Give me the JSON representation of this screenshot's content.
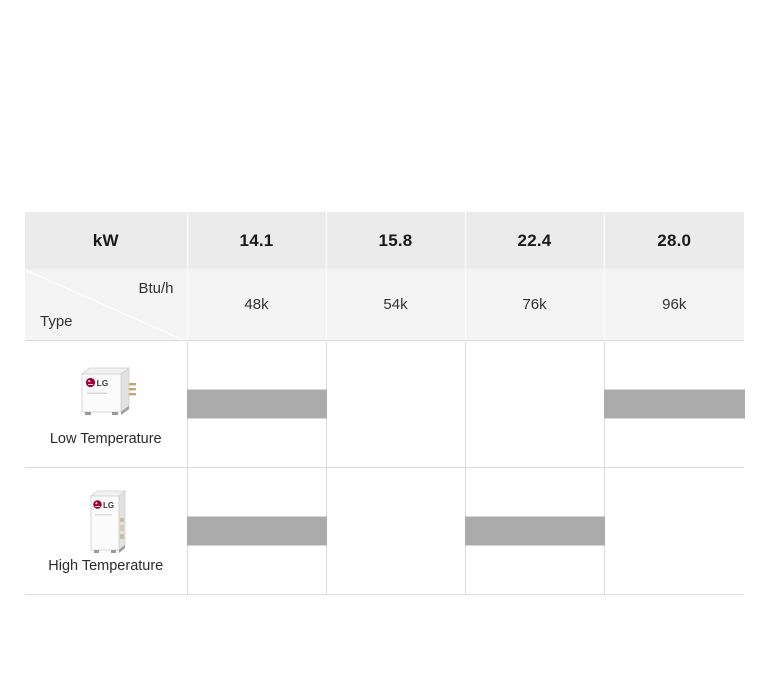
{
  "table": {
    "unit_header_label": "kW",
    "kw_values": [
      "14.1",
      "15.8",
      "22.4",
      "28.0"
    ],
    "sub_header": {
      "top_label": "Btu/h",
      "bottom_label": "Type"
    },
    "btu_values": [
      "48k",
      "54k",
      "76k",
      "96k"
    ],
    "rows": [
      {
        "type_label": "Low Temperature",
        "product_icon": "lg-hydro-kit-low-temperature-unit",
        "availability": [
          true,
          false,
          false,
          true
        ]
      },
      {
        "type_label": "High Temperature",
        "product_icon": "lg-hydro-kit-high-temperature-unit",
        "availability": [
          true,
          false,
          true,
          false
        ]
      }
    ]
  },
  "colors": {
    "header_background": "#EBEBEB",
    "subheader_background": "#F4F4F4",
    "bar_fill": "#ABABAB",
    "border": "#DCDCDC",
    "page_background": "#FFFFFF",
    "brand_red": "#A50034"
  }
}
